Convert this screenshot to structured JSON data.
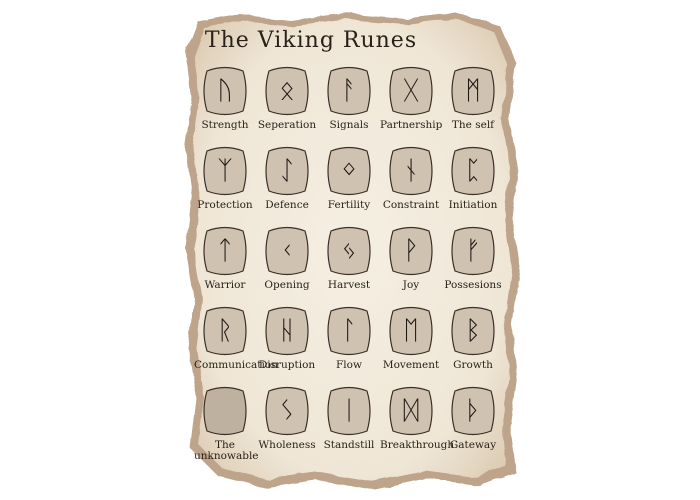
{
  "title": "The Viking Runes",
  "colors": {
    "parchment": "#f1eadc",
    "burn": "#8a5a2f",
    "stone_fill": "#cfc2b1",
    "ink": "#2a211a"
  },
  "runes": [
    {
      "label": "Strength",
      "glyph": "ᚢ"
    },
    {
      "label": "Seperation",
      "glyph": "ᛟ"
    },
    {
      "label": "Signals",
      "glyph": "ᚨ"
    },
    {
      "label": "Partnership",
      "glyph": "ᚷ"
    },
    {
      "label": "The self",
      "glyph": "ᛗ"
    },
    {
      "label": "Protection",
      "glyph": "ᛉ"
    },
    {
      "label": "Defence",
      "glyph": "ᛇ"
    },
    {
      "label": "Fertility",
      "glyph": "ᛜ"
    },
    {
      "label": "Constraint",
      "glyph": "ᚾ"
    },
    {
      "label": "Initiation",
      "glyph": "ᛈ"
    },
    {
      "label": "Warrior",
      "glyph": "ᛏ"
    },
    {
      "label": "Opening",
      "glyph": "ᚲ"
    },
    {
      "label": "Harvest",
      "glyph": "ᛃ"
    },
    {
      "label": "Joy",
      "glyph": "ᚹ"
    },
    {
      "label": "Possesions",
      "glyph": "ᚠ"
    },
    {
      "label": "Communication",
      "glyph": "ᚱ"
    },
    {
      "label": "Disruption",
      "glyph": "ᚺ"
    },
    {
      "label": "Flow",
      "glyph": "ᛚ"
    },
    {
      "label": "Movement",
      "glyph": "ᛖ"
    },
    {
      "label": "Growth",
      "glyph": "ᛒ"
    },
    {
      "label": "The unknowable",
      "glyph": ""
    },
    {
      "label": "Wholeness",
      "glyph": "ᛊ"
    },
    {
      "label": "Standstill",
      "glyph": "ᛁ"
    },
    {
      "label": "Breakthrough",
      "glyph": "ᛞ"
    },
    {
      "label": "Gateway",
      "glyph": "ᚦ"
    }
  ]
}
